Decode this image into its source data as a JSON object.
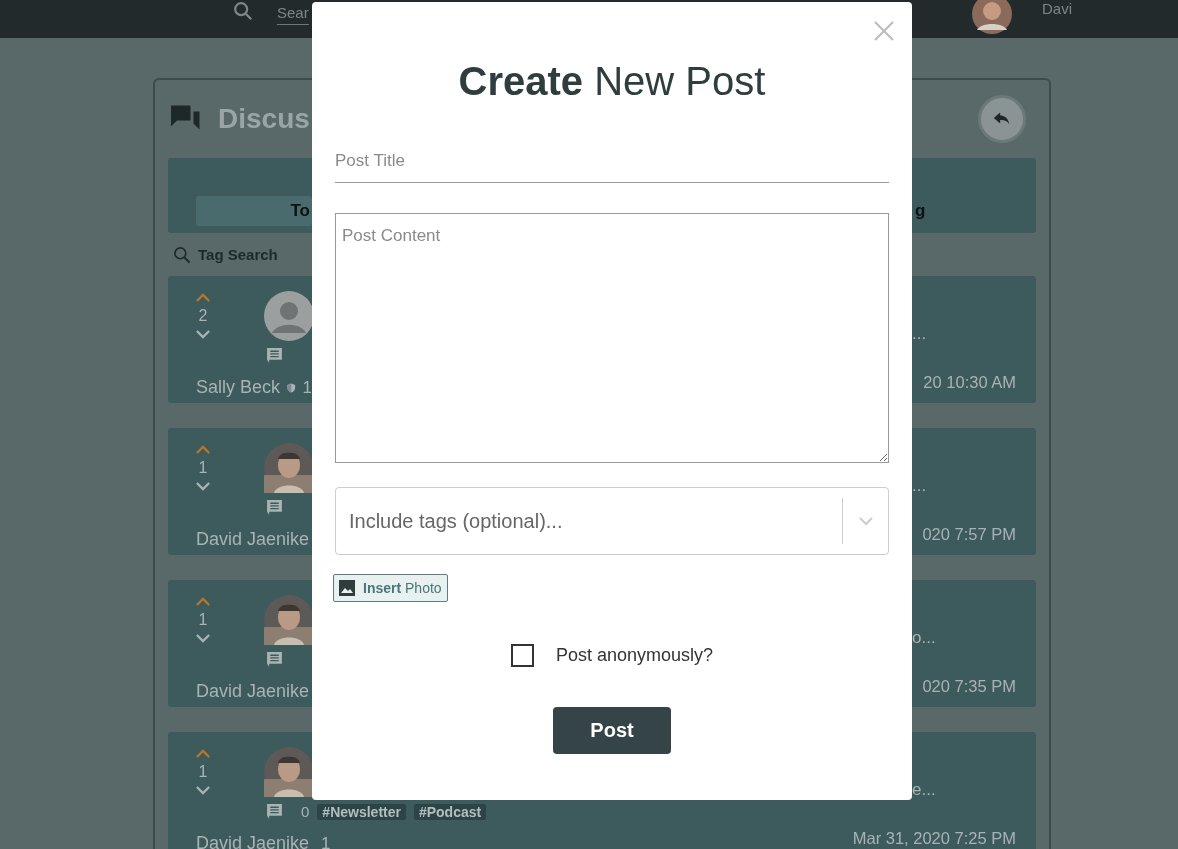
{
  "nav": {
    "search_placeholder": "Sear",
    "user_name": "Davi"
  },
  "panel": {
    "title": "Discus",
    "tabs": [
      {
        "label": "To",
        "selected": true
      },
      {
        "label": "g",
        "selected": false
      }
    ],
    "tag_search": "Tag Search"
  },
  "posts": [
    {
      "avatar": {
        "kind": "default"
      },
      "votes": "2",
      "upvoted": true,
      "author": "Sally Beck",
      "author_badge": "1",
      "excerpt_tail": "...",
      "date_tail": "20 10:30 AM"
    },
    {
      "votes": "1",
      "upvoted": true,
      "author": "David Jaenike",
      "excerpt_tail": "...",
      "date_tail": "020 7:57 PM"
    },
    {
      "votes": "1",
      "upvoted": true,
      "author": "David Jaenike",
      "excerpt_tail": "o...",
      "date_tail": "020 7:35 PM"
    },
    {
      "votes": "1",
      "upvoted": true,
      "author": "David Jaenike",
      "author_badge": "1",
      "comment_count": "0",
      "tags": [
        "#Newsletter",
        "#Podcast"
      ],
      "excerpt_tail": "e...",
      "date_tail": "Mar 31, 2020 7:25 PM"
    }
  ],
  "modal": {
    "title": "**Create** New Post",
    "title_field": {
      "placeholder": "Post Title"
    },
    "content_field": {
      "placeholder": "Post Content"
    },
    "tags_field": {
      "placeholder": "Include tags (optional)..."
    },
    "insert_photo": "**Insert** Photo",
    "anonymous": {
      "label": "Post anonymously?",
      "checked": false
    },
    "submit": "Post"
  }
}
